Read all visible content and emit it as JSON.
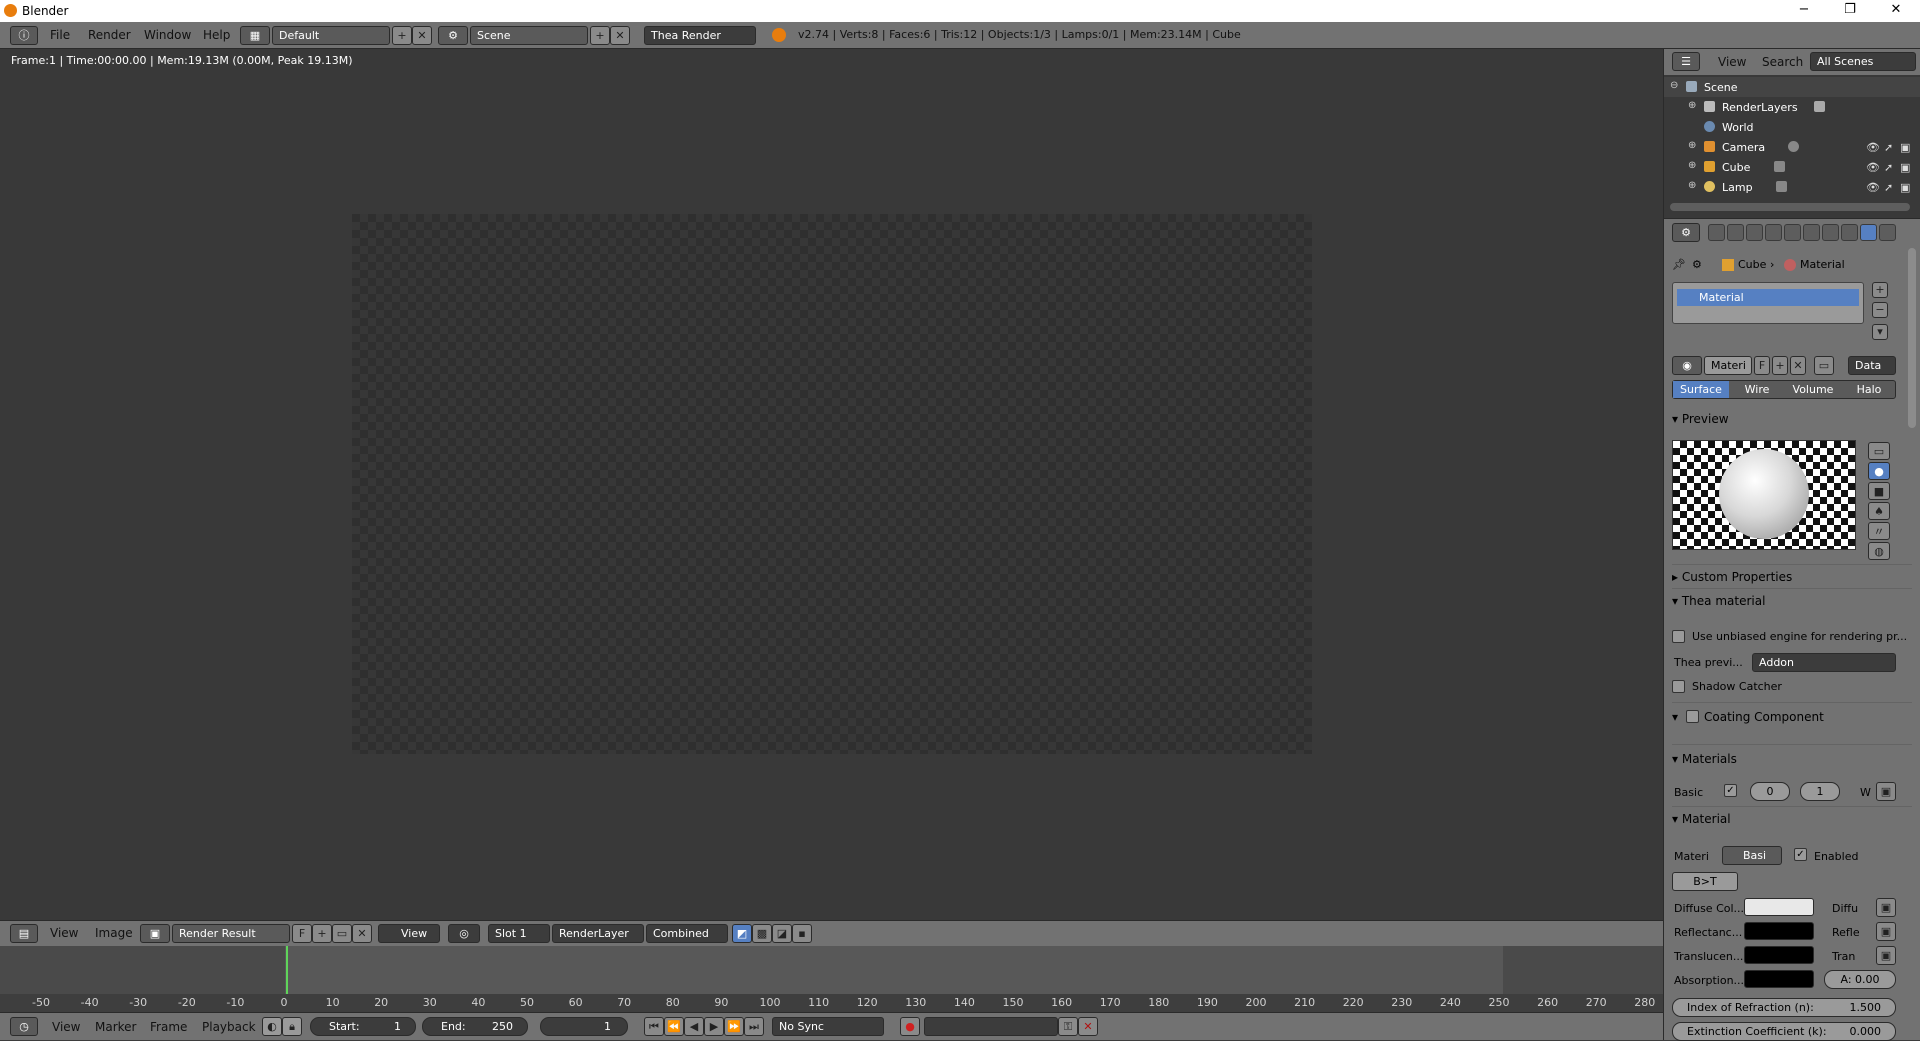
{
  "window": {
    "title": "Blender",
    "minimize": "−",
    "maximize": "❐",
    "close": "✕"
  },
  "topbar": {
    "menus": [
      "File",
      "Render",
      "Window",
      "Help"
    ],
    "layout": "Default",
    "scene": "Scene",
    "engine": "Thea Render",
    "stats": "v2.74 | Verts:8 | Faces:6 | Tris:12 | Objects:1/3 | Lamps:0/1 | Mem:23.14M | Cube"
  },
  "viewport": {
    "info": "Frame:1 | Time:00:00.00 | Mem:19.13M (0.00M, Peak 19.13M)"
  },
  "image_header": {
    "menus": [
      "View",
      "Image"
    ],
    "image": "Render Result",
    "f": "F",
    "view": "View",
    "slot": "Slot 1",
    "layer": "RenderLayer",
    "pass": "Combined"
  },
  "timeline": {
    "ticks": [
      "-50",
      "-40",
      "-30",
      "-20",
      "-10",
      "0",
      "10",
      "20",
      "30",
      "40",
      "50",
      "60",
      "70",
      "80",
      "90",
      "100",
      "110",
      "120",
      "130",
      "140",
      "150",
      "160",
      "170",
      "180",
      "190",
      "200",
      "210",
      "220",
      "230",
      "240",
      "250",
      "260",
      "270",
      "280"
    ]
  },
  "bottom_header": {
    "menus": [
      "View",
      "Marker",
      "Frame",
      "Playback"
    ],
    "start_label": "Start:",
    "start_value": "1",
    "end_label": "End:",
    "end_value": "250",
    "current": "1",
    "sync": "No Sync"
  },
  "outliner": {
    "menus": [
      "View",
      "Search"
    ],
    "filter": "All Scenes",
    "items": [
      {
        "label": "Scene",
        "indent": 0
      },
      {
        "label": "RenderLayers",
        "indent": 1
      },
      {
        "label": "World",
        "indent": 1
      },
      {
        "label": "Camera",
        "indent": 1
      },
      {
        "label": "Cube",
        "indent": 1
      },
      {
        "label": "Lamp",
        "indent": 1
      }
    ]
  },
  "properties": {
    "breadcrumb_object": "Cube",
    "breadcrumb_material": "Material",
    "slot_name": "Material",
    "material_name": "Materi",
    "f": "F",
    "data": "Data",
    "tabs": [
      "Surface",
      "Wire",
      "Volume",
      "Halo"
    ],
    "preview_title": "Preview",
    "custom_props": "Custom Properties",
    "thea_title": "Thea material",
    "unbiased_label": "Use unbiased engine for rendering pr...",
    "thea_preview_label": "Thea previ...",
    "thea_preview_value": "Addon",
    "shadow_catcher": "Shadow Catcher",
    "coating": "Coating Component",
    "materials_title": "Materials",
    "basic_label": "Basic",
    "basic_v1": "0",
    "basic_v2": "1",
    "w_label": "W",
    "material_title": "Material",
    "materi_label": "Materi",
    "basi_value": "Basi",
    "enabled_label": "Enabled",
    "bt_button": "B>T",
    "rows": [
      {
        "label": "Diffuse Col...",
        "right": "Diffu",
        "color": "#e8e8e8"
      },
      {
        "label": "Reflectanc...",
        "right": "Refle",
        "color": "#000000"
      },
      {
        "label": "Translucen...",
        "right": "Tran",
        "color": "#000000"
      },
      {
        "label": "Absorption...",
        "right": "A: 0.00",
        "color": "#000000"
      }
    ],
    "ior_label": "Index of Refraction (n):",
    "ior_value": "1.500",
    "extinction_label": "Extinction Coefficient (k):",
    "extinction_value": "0.000"
  }
}
